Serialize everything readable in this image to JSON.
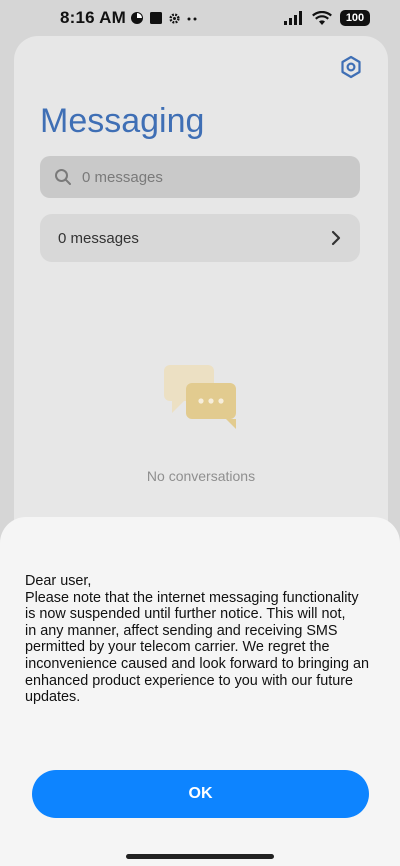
{
  "status_bar": {
    "time": "8:16 AM",
    "battery": "100",
    "icons": [
      "pie-status-icon",
      "square-status-icon",
      "gear-status-icon",
      "more-dots-icon",
      "signal-icon",
      "wifi-icon",
      "battery-icon"
    ]
  },
  "app": {
    "title": "Messaging",
    "settings_icon": "hexagon-settings-icon",
    "search": {
      "placeholder": "0 messages"
    },
    "messages_row": {
      "label": "0 messages"
    },
    "empty_state": {
      "text": "No conversations"
    }
  },
  "dialog": {
    "lines": [
      "Dear user,",
      "Please note that the internet messaging functionality",
      "is now suspended until further notice. This will not,",
      "in any manner, affect sending and receiving SMS",
      "permitted by your telecom carrier. We regret the",
      "inconvenience caused and look forward to bringing an",
      "enhanced product experience to you with our future",
      "updates."
    ],
    "ok_label": "OK"
  },
  "colors": {
    "accent": "#0d84ff",
    "title_blue": "#3f6fb5",
    "dim_background": "#d6d6d6",
    "sheet_background": "#f5f5f5"
  }
}
